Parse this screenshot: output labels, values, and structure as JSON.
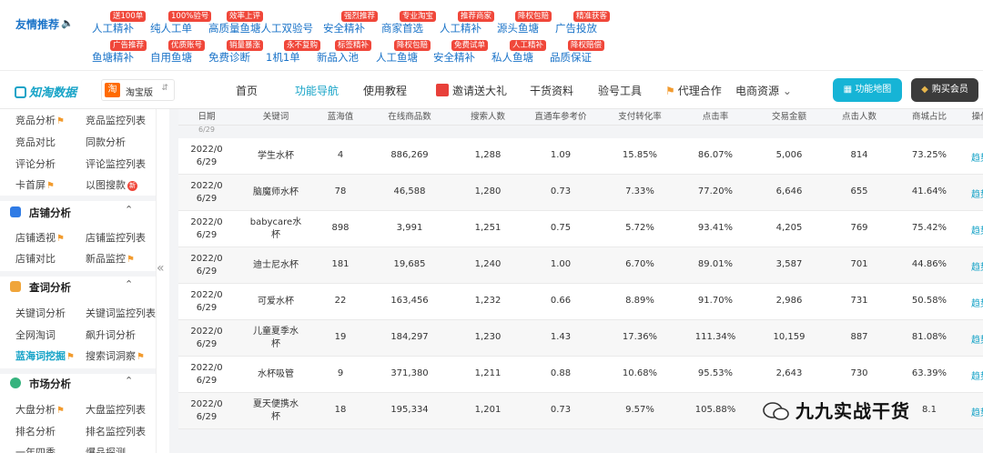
{
  "friend_links": {
    "title": "友情推荐",
    "row1": [
      {
        "label": "人工精补",
        "tag": "送100单"
      },
      {
        "label": "纯人工单",
        "tag": "100%验号"
      },
      {
        "label": "高质量鱼塘人工双验号",
        "tag": "效率上评"
      },
      {
        "label": "安全精补",
        "tag": "强烈推荐"
      },
      {
        "label": "商家首选",
        "tag": "专业淘宝"
      },
      {
        "label": "人工精补",
        "tag": "推荐商家"
      },
      {
        "label": "源头鱼塘",
        "tag": "降权包赔"
      },
      {
        "label": "广告投放",
        "tag": "精准获客"
      }
    ],
    "row2": [
      {
        "label": "鱼塘精补",
        "tag": "广告推荐"
      },
      {
        "label": "自用鱼塘",
        "tag": "优质账号"
      },
      {
        "label": "免费诊断",
        "tag": "销量暴涨"
      },
      {
        "label": "1机1单",
        "tag": "永不复购"
      },
      {
        "label": "新品入池",
        "tag": "标签精补"
      },
      {
        "label": "人工鱼塘",
        "tag": "降权包赔"
      },
      {
        "label": "安全精补",
        "tag": "免费试单"
      },
      {
        "label": "私人鱼塘",
        "tag": "人工精补"
      },
      {
        "label": "品质保证",
        "tag": "降权赔偿"
      }
    ]
  },
  "nav": {
    "logo": "知淘数据",
    "platform_icon": "淘",
    "platform": "淘宝版",
    "items": [
      "首页",
      "功能导航",
      "使用教程",
      "邀请送大礼",
      "干货资料",
      "验号工具",
      "代理合作",
      "电商资源"
    ],
    "map_button": "功能地图",
    "buy_button": "购买会员"
  },
  "sidebar": {
    "top_items": [
      "竞品分析",
      "竞品监控列表",
      "竞品对比",
      "同款分析",
      "评论分析",
      "评论监控列表",
      "卡首屏",
      "以图搜款"
    ],
    "groups": [
      {
        "label": "店铺分析",
        "items": [
          "店铺透视",
          "店铺监控列表",
          "店铺对比",
          "新品监控"
        ]
      },
      {
        "label": "查词分析",
        "items": [
          "关键词分析",
          "关键词监控列表",
          "全网淘词",
          "飙升词分析",
          "蓝海词挖掘",
          "搜索词洞察"
        ]
      },
      {
        "label": "市场分析",
        "items": [
          "大盘分析",
          "大盘监控列表",
          "排名分析",
          "排名监控列表",
          "一年四季",
          "爆品探测"
        ]
      }
    ],
    "new_badge": "新"
  },
  "table": {
    "headers": [
      "日期",
      "关键词",
      "蓝海值",
      "在线商品数",
      "搜索人数",
      "直通车参考价",
      "支付转化率",
      "点击率",
      "交易金额",
      "点击人数",
      "商城占比",
      "操作"
    ],
    "stub_text": "6/29",
    "rows": [
      {
        "date1": "2022/0",
        "date2": "6/29",
        "kw1": "学生水杯",
        "kw2": "",
        "blue": "4",
        "online": "886,269",
        "search": "1,288",
        "ztc": "1.09",
        "conv": "15.85%",
        "ctr": "86.07%",
        "amount": "5,006",
        "clicks": "814",
        "mall": "73.25%",
        "op": "趋势"
      },
      {
        "date1": "2022/0",
        "date2": "6/29",
        "kw1": "脑魔师水杯",
        "kw2": "",
        "blue": "78",
        "online": "46,588",
        "search": "1,280",
        "ztc": "0.73",
        "conv": "7.33%",
        "ctr": "77.20%",
        "amount": "6,646",
        "clicks": "655",
        "mall": "41.64%",
        "op": "趋势"
      },
      {
        "date1": "2022/0",
        "date2": "6/29",
        "kw1": "babycare水",
        "kw2": "杯",
        "blue": "898",
        "online": "3,991",
        "search": "1,251",
        "ztc": "0.75",
        "conv": "5.72%",
        "ctr": "93.41%",
        "amount": "4,205",
        "clicks": "769",
        "mall": "75.42%",
        "op": "趋势"
      },
      {
        "date1": "2022/0",
        "date2": "6/29",
        "kw1": "迪士尼水杯",
        "kw2": "",
        "blue": "181",
        "online": "19,685",
        "search": "1,240",
        "ztc": "1.00",
        "conv": "6.70%",
        "ctr": "89.01%",
        "amount": "3,587",
        "clicks": "701",
        "mall": "44.86%",
        "op": "趋势"
      },
      {
        "date1": "2022/0",
        "date2": "6/29",
        "kw1": "可爱水杯",
        "kw2": "",
        "blue": "22",
        "online": "163,456",
        "search": "1,232",
        "ztc": "0.66",
        "conv": "8.89%",
        "ctr": "91.70%",
        "amount": "2,986",
        "clicks": "731",
        "mall": "50.58%",
        "op": "趋势"
      },
      {
        "date1": "2022/0",
        "date2": "6/29",
        "kw1": "儿童夏季水",
        "kw2": "杯",
        "blue": "19",
        "online": "184,297",
        "search": "1,230",
        "ztc": "1.43",
        "conv": "17.36%",
        "ctr": "111.34%",
        "amount": "10,159",
        "clicks": "887",
        "mall": "81.08%",
        "op": "趋势"
      },
      {
        "date1": "2022/0",
        "date2": "6/29",
        "kw1": "水杯吸管",
        "kw2": "",
        "blue": "9",
        "online": "371,380",
        "search": "1,211",
        "ztc": "0.88",
        "conv": "10.68%",
        "ctr": "95.53%",
        "amount": "2,643",
        "clicks": "730",
        "mall": "63.39%",
        "op": "趋势"
      },
      {
        "date1": "2022/0",
        "date2": "6/29",
        "kw1": "夏天便携水",
        "kw2": "杯",
        "blue": "18",
        "online": "195,334",
        "search": "1,201",
        "ztc": "0.73",
        "conv": "9.57%",
        "ctr": "105.88%",
        "amount": "",
        "clicks": "",
        "mall": "8.1",
        "op": "趋势"
      }
    ]
  },
  "watermark": "九九实战干货",
  "colors": {
    "accent": "#16a3c7",
    "tag_red": "#f0473a",
    "badge_orange": "#f29b2e"
  }
}
